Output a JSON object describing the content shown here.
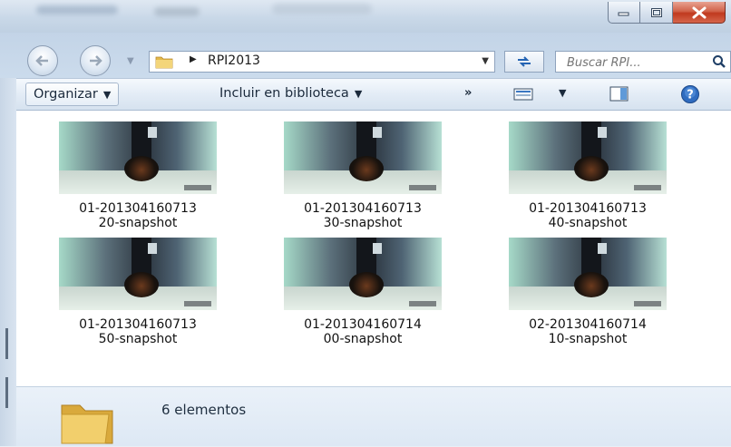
{
  "window": {
    "minimize_label": "",
    "maximize_label": "",
    "close_label": ""
  },
  "address": {
    "path": "RPI2013",
    "search_placeholder": "Buscar RPI..."
  },
  "command_bar": {
    "organize": "Organizar",
    "include": "Incluir en biblioteca",
    "more": "»"
  },
  "files": [
    {
      "line1": "01-201304160713",
      "line2": "20-snapshot"
    },
    {
      "line1": "01-201304160713",
      "line2": "30-snapshot"
    },
    {
      "line1": "01-201304160713",
      "line2": "40-snapshot"
    },
    {
      "line1": "01-201304160713",
      "line2": "50-snapshot"
    },
    {
      "line1": "01-201304160714",
      "line2": "00-snapshot"
    },
    {
      "line1": "02-201304160714",
      "line2": "10-snapshot"
    }
  ],
  "details": {
    "count": "6 elementos"
  },
  "colors": {
    "accent": "#2463b3",
    "close_button": "#c0391f",
    "folder": "#e8c15a"
  },
  "icons": [
    "back-arrow-icon",
    "forward-arrow-icon",
    "folder-icon",
    "refresh-icon",
    "search-icon",
    "view-icon",
    "preview-pane-icon",
    "help-icon",
    "chevron-down-icon"
  ]
}
